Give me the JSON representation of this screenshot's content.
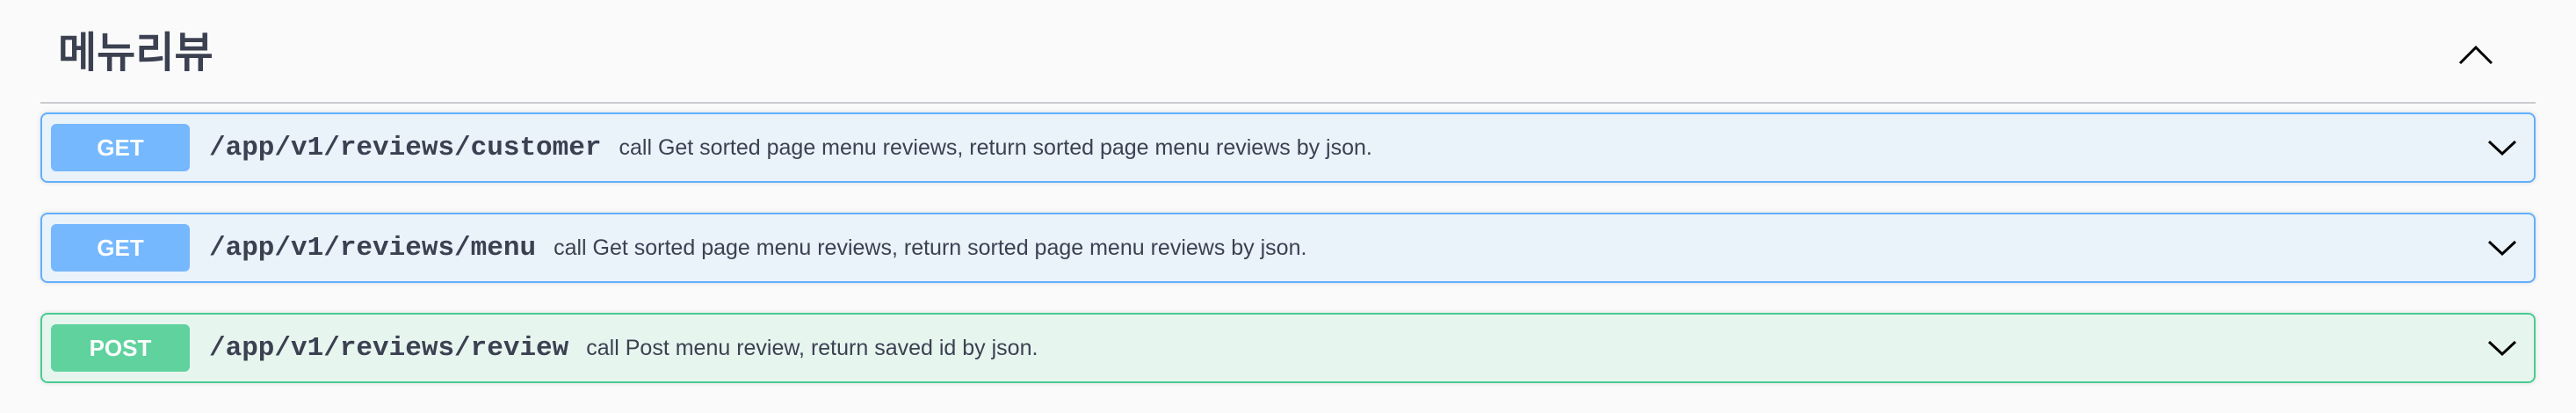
{
  "tag": {
    "title": "메뉴리뷰",
    "collapse_icon": "chevron-up-icon"
  },
  "operations": [
    {
      "method": "GET",
      "path": "/app/v1/reviews/customer",
      "summary": "call Get sorted page menu reviews, return sorted page menu reviews by json.",
      "expand_icon": "chevron-down-icon"
    },
    {
      "method": "GET",
      "path": "/app/v1/reviews/menu",
      "summary": "call Get sorted page menu reviews, return sorted page menu reviews by json.",
      "expand_icon": "chevron-down-icon"
    },
    {
      "method": "POST",
      "path": "/app/v1/reviews/review",
      "summary": "call Post menu review, return saved id by json.",
      "expand_icon": "chevron-down-icon"
    }
  ],
  "colors": {
    "get": "#61affe",
    "post": "#49cc90",
    "text": "#3b4151"
  }
}
